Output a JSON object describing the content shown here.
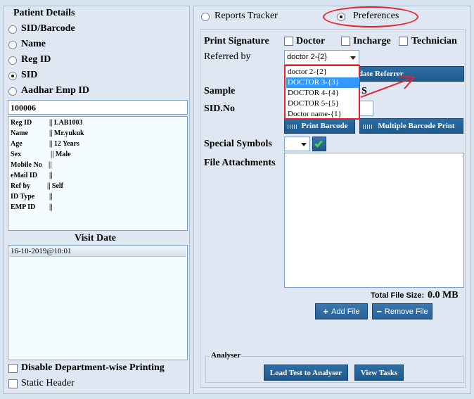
{
  "left": {
    "title": "Patient Details",
    "search_options": [
      "SID/Barcode",
      "Name",
      "Reg ID",
      "SID",
      "Aadhar Emp ID"
    ],
    "selected_option": "SID",
    "search_value": "100006",
    "info": [
      {
        "label": "Reg ID",
        "value": "|| LAB1003"
      },
      {
        "label": "Name",
        "value": "|| Mr.yukuk"
      },
      {
        "label": "Age",
        "value": "|| 12 Years"
      },
      {
        "label": "Sex",
        "value": "|| Male"
      },
      {
        "label": "Mobile No",
        "value": "||"
      },
      {
        "label": "eMail ID",
        "value": "||"
      },
      {
        "label": "Ref by",
        "value": "|| Self"
      },
      {
        "label": "ID Type",
        "value": "||"
      },
      {
        "label": "EMP ID",
        "value": "||"
      }
    ],
    "visit_date_title": "Visit Date",
    "visit_dates": [
      "16-10-2019@10:01"
    ],
    "disable_dept_printing": "Disable Department-wise Printing",
    "static_header": "Static Header"
  },
  "right": {
    "tab_reports": "Reports Tracker",
    "tab_preferences": "Preferences",
    "selected_tab": "Preferences",
    "print_signature_label": "Print Signature",
    "sig_doctor": "Doctor",
    "sig_incharge": "Incharge",
    "sig_technician": "Technician",
    "referred_by_label": "Referred by",
    "referred_by_value": "doctor 2-{2}",
    "dropdown_options": [
      "doctor 2-{2}",
      "DOCTOR 3-{3}",
      "DOCTOR 4-{4}",
      "DOCTOR 5-{5}",
      "Doctor name-{1}"
    ],
    "dropdown_highlighted": "DOCTOR 3-{3}",
    "update_referrer_label": "date Referrer",
    "sample_label": "Sample",
    "sample_value_fragment": "S",
    "sid_no_label": "SID.No",
    "print_barcode_label": "Print Barcode",
    "multiple_barcode_label": "Multiple Barcode Print",
    "special_symbols_label": "Special Symbols",
    "file_attachments_label": "File Attachments",
    "total_file_size_label": "Total File Size:",
    "total_file_size_value": "0.0 MB",
    "add_file_label": "Add File",
    "remove_file_label": "Remove File",
    "analyser_title": "Analyser",
    "load_test_label": "Load Test to Analyser",
    "view_tasks_label": "View Tasks"
  },
  "colors": {
    "background": "#d7e3ef",
    "button": "#2b6aa0",
    "annotation_red": "#e8202a",
    "selection": "#3399ff"
  }
}
